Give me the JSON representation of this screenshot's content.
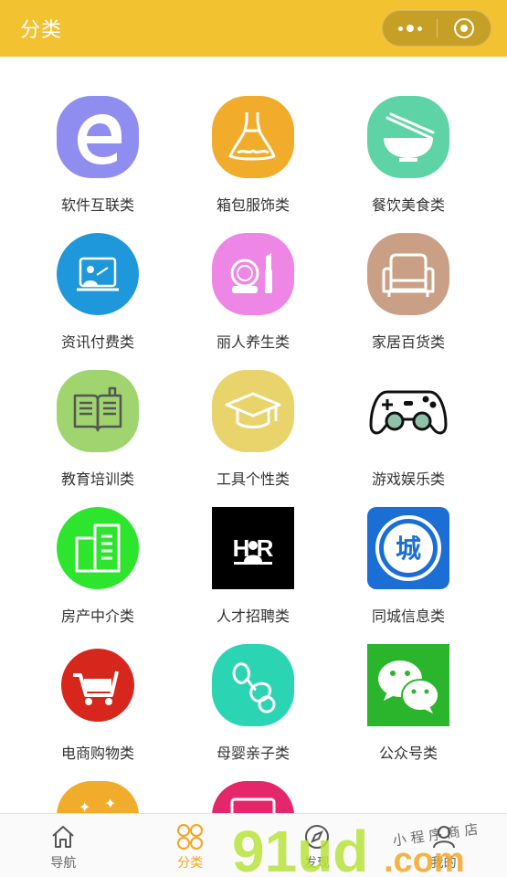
{
  "header": {
    "title": "分类"
  },
  "categories": [
    {
      "label": "软件互联类",
      "icon": "edge-icon",
      "color": "#8f8ef0"
    },
    {
      "label": "箱包服饰类",
      "icon": "dress-icon",
      "color": "#f2ac2c"
    },
    {
      "label": "餐饮美食类",
      "icon": "bowl-icon",
      "color": "#5ed3a6"
    },
    {
      "label": "资讯付费类",
      "icon": "presentation-icon",
      "color": "#1f97db"
    },
    {
      "label": "丽人养生类",
      "icon": "cosmetics-icon",
      "color": "#ed86e5"
    },
    {
      "label": "家居百货类",
      "icon": "sofa-icon",
      "color": "#c9a086"
    },
    {
      "label": "教育培训类",
      "icon": "book-icon",
      "color": "#9fd46f"
    },
    {
      "label": "工具个性类",
      "icon": "graduation-cap-icon",
      "color": "#e9d36b"
    },
    {
      "label": "游戏娱乐类",
      "icon": "gamepad-icon",
      "color": "#ffffff"
    },
    {
      "label": "房产中介类",
      "icon": "building-icon",
      "color": "#2de52d"
    },
    {
      "label": "人才招聘类",
      "icon": "hr-icon",
      "color": "#000000"
    },
    {
      "label": "同城信息类",
      "icon": "city-icon",
      "color": "#1b6fd4"
    },
    {
      "label": "电商购物类",
      "icon": "cart-icon",
      "color": "#d7261c"
    },
    {
      "label": "母婴亲子类",
      "icon": "pacifier-icon",
      "color": "#2bd5b4"
    },
    {
      "label": "公众号类",
      "icon": "wechat-icon",
      "color": "#2bb52d"
    },
    {
      "label": "",
      "icon": "stars-icon",
      "color": "#f2ac2c"
    },
    {
      "label": "",
      "icon": "screen-icon",
      "color": "#e4266a"
    }
  ],
  "tabbar": {
    "tabs": [
      {
        "label": "导航",
        "icon": "home-icon"
      },
      {
        "label": "分类",
        "icon": "grid-icon",
        "active": true
      },
      {
        "label": "发现",
        "icon": "compass-icon"
      },
      {
        "label": "我的",
        "icon": "user-icon"
      }
    ]
  },
  "watermark": {
    "brand": "91ud",
    "suffix": ".com",
    "tagline": "小 程 序 商 店"
  },
  "colors": {
    "header": "#f2c230",
    "active_tab": "#f2a51d"
  }
}
